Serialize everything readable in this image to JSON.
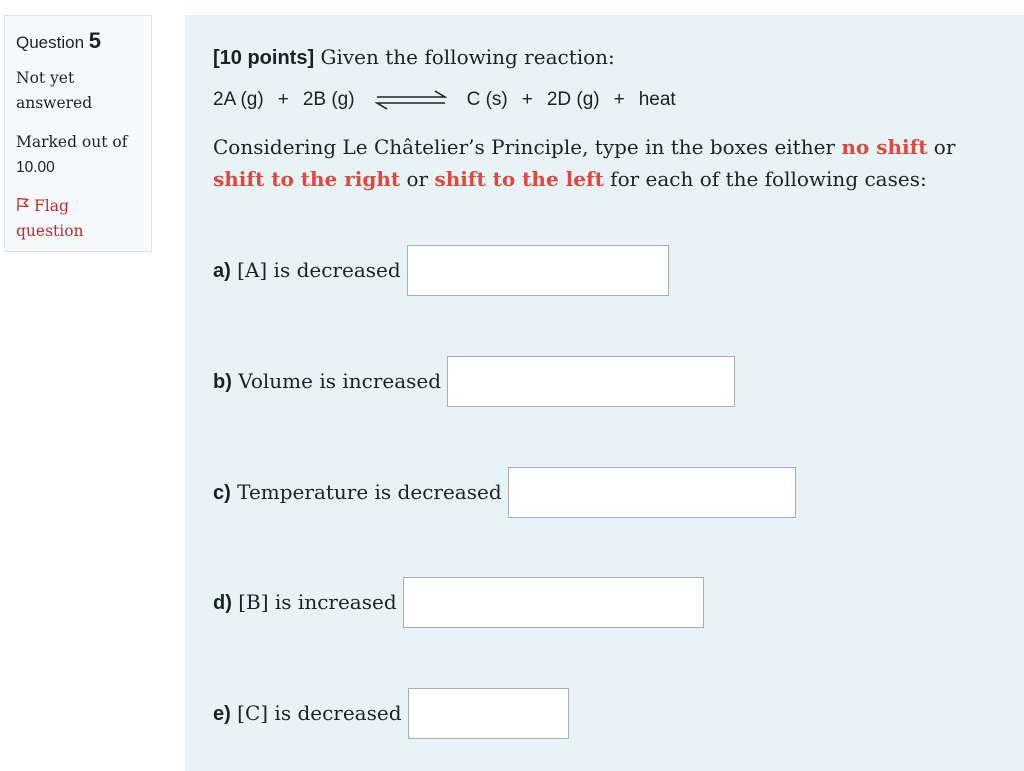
{
  "sidebar": {
    "question_label": "Question",
    "question_number": "5",
    "state": "Not yet answered",
    "marked_out_of_label": "Marked out of",
    "marked_out_of_value": "10.00",
    "flag_label": "Flag question"
  },
  "question": {
    "points_label": "[10 points]",
    "intro_text": " Given the following reaction:",
    "reaction": {
      "reactant1": "2A (g)",
      "plus1": "+",
      "reactant2": "2B (g)",
      "product1": "C (s)",
      "plus2": "+",
      "product2": "2D (g)",
      "plus3": "+",
      "heat": "heat"
    },
    "instruction": {
      "part1": "Considering Le Châtelier’s Principle, type in the boxes either ",
      "option1": "no shift",
      "or1": " or ",
      "option2": "shift to the right",
      "or2": " or ",
      "option3": "shift to the left",
      "part2": " for each of the following cases:"
    },
    "items": [
      {
        "letter": "a)",
        "text": " [A] is decreased",
        "value": ""
      },
      {
        "letter": "b)",
        "text": " Volume is increased",
        "value": ""
      },
      {
        "letter": "c)",
        "text": " Temperature is decreased",
        "value": ""
      },
      {
        "letter": "d)",
        "text": " [B] is increased",
        "value": ""
      },
      {
        "letter": "e)",
        "text": " [C] is decreased",
        "value": ""
      }
    ]
  },
  "colors": {
    "accent_red": "#e0473f",
    "panel_bg": "#e7f3f5",
    "flag_red": "#c2292f"
  },
  "icons": {
    "flag": "flag-outline-icon",
    "equilibrium": "equilibrium-arrows-icon"
  }
}
